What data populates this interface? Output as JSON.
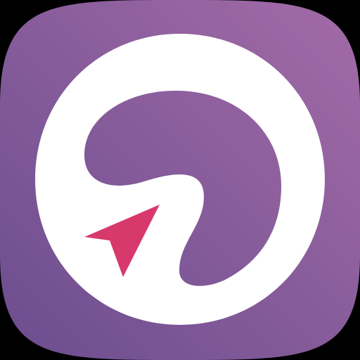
{
  "icon": {
    "name": "app-icon",
    "symbol": "white-ring-with-navigation-arrow",
    "colors": {
      "background_top_right": "#a36ba7",
      "background_bottom_left": "#6b4d8e",
      "ring": "#ffffff",
      "arrow": "#d8396c",
      "outside": "#000000"
    }
  }
}
